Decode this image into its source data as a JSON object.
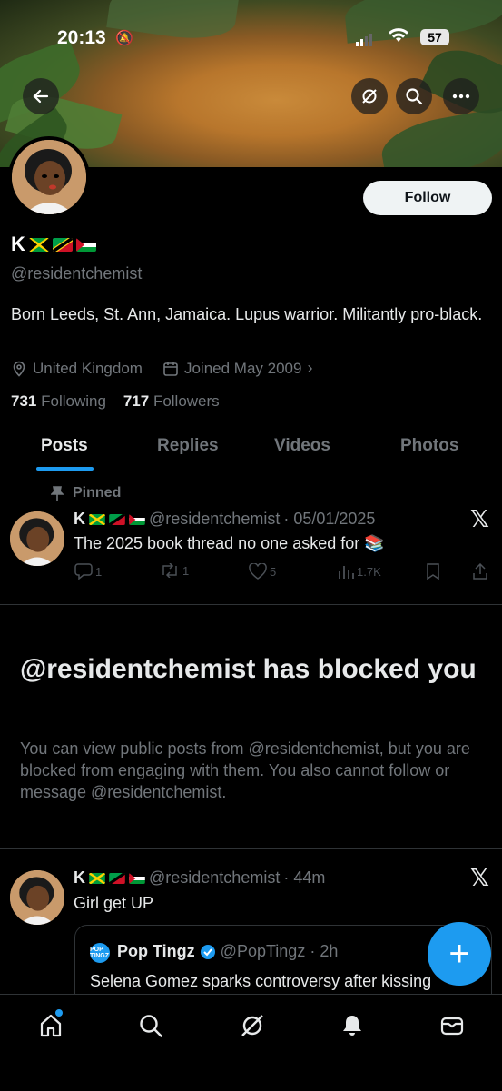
{
  "status_bar": {
    "time": "20:13",
    "battery": "57"
  },
  "profile": {
    "display_name": "K",
    "handle": "@residentchemist",
    "bio": "Born Leeds, St. Ann, Jamaica. Lupus warrior. Militantly pro-black.",
    "location": "United Kingdom",
    "joined": "Joined May 2009",
    "following_count": "731",
    "following_label": "Following",
    "followers_count": "717",
    "followers_label": "Followers",
    "follow_button": "Follow"
  },
  "tabs": [
    "Posts",
    "Replies",
    "Videos",
    "Photos"
  ],
  "pinned_post": {
    "pinned_label": "Pinned",
    "author": "K",
    "handle": "@residentchemist",
    "date": "· 05/01/2025",
    "text": "The 2025 book thread no one asked for",
    "replies": "1",
    "reposts": "1",
    "likes": "5",
    "views": "1.7K"
  },
  "blocked": {
    "title": "@residentchemist has blocked you",
    "body": "You can view public posts from @residentchemist, but you are blocked from engaging with them. You also cannot follow or message @residentchemist."
  },
  "latest_post": {
    "author": "K",
    "handle": "@residentchemist",
    "time": "· 44m",
    "text": "Girl get UP",
    "quote": {
      "logo_text": "POP TINGZ",
      "name": "Pop Tingz",
      "handle": "@PopTingz",
      "time": "· 2h",
      "text": "Selena Gomez sparks controversy after kissing"
    }
  },
  "colors": {
    "accent": "#1d9bf0",
    "muted": "#71767b",
    "text": "#e7e9ea",
    "border": "#2f3336"
  },
  "icons": [
    "back-arrow-icon",
    "grok-icon",
    "search-icon",
    "more-icon",
    "map-pin-icon",
    "calendar-icon",
    "pin-icon",
    "x-logo-icon",
    "reply-icon",
    "repost-icon",
    "like-icon",
    "views-icon",
    "bookmark-icon",
    "share-icon",
    "verified-badge-icon",
    "compose-plus-icon",
    "home-icon",
    "notifications-icon",
    "messages-icon"
  ]
}
